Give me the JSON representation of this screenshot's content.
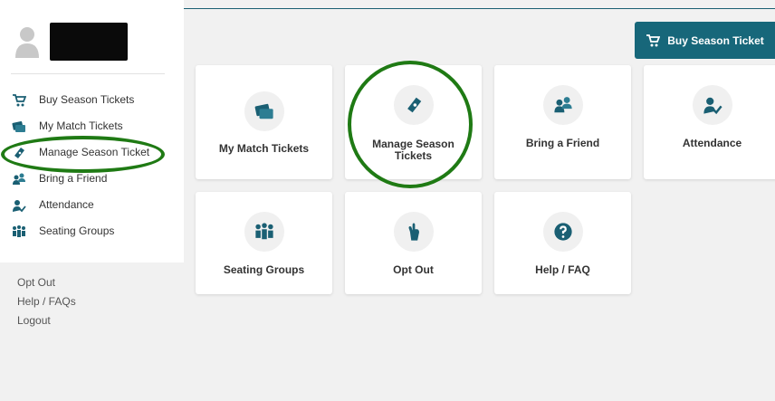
{
  "colors": {
    "accent": "#17677a",
    "icon": "#1a5f73",
    "highlight_ring": "#1f7a14"
  },
  "sidebar": {
    "user_name_redacted": true,
    "items": [
      {
        "label": "Buy Season Tickets",
        "icon": "cart-icon"
      },
      {
        "label": "My Match Tickets",
        "icon": "tickets-icon"
      },
      {
        "label": "Manage Season Ticket",
        "icon": "ticket-stub-icon"
      },
      {
        "label": "Bring a Friend",
        "icon": "friends-icon"
      },
      {
        "label": "Attendance",
        "icon": "attendance-icon"
      },
      {
        "label": "Seating Groups",
        "icon": "seating-group-icon"
      }
    ],
    "links": [
      "Opt Out",
      "Help / FAQs",
      "Logout"
    ]
  },
  "header": {
    "buy_button_label": "Buy Season Ticket"
  },
  "cards": [
    {
      "label": "My Match Tickets",
      "icon": "tickets-icon"
    },
    {
      "label": "Manage Season Tickets",
      "icon": "ticket-stub-icon"
    },
    {
      "label": "Bring a Friend",
      "icon": "friends-icon"
    },
    {
      "label": "Attendance",
      "icon": "attendance-icon"
    },
    {
      "label": "Seating Groups",
      "icon": "seating-group-icon"
    },
    {
      "label": "Opt Out",
      "icon": "hand-icon"
    },
    {
      "label": "Help / FAQ",
      "icon": "help-icon"
    }
  ]
}
